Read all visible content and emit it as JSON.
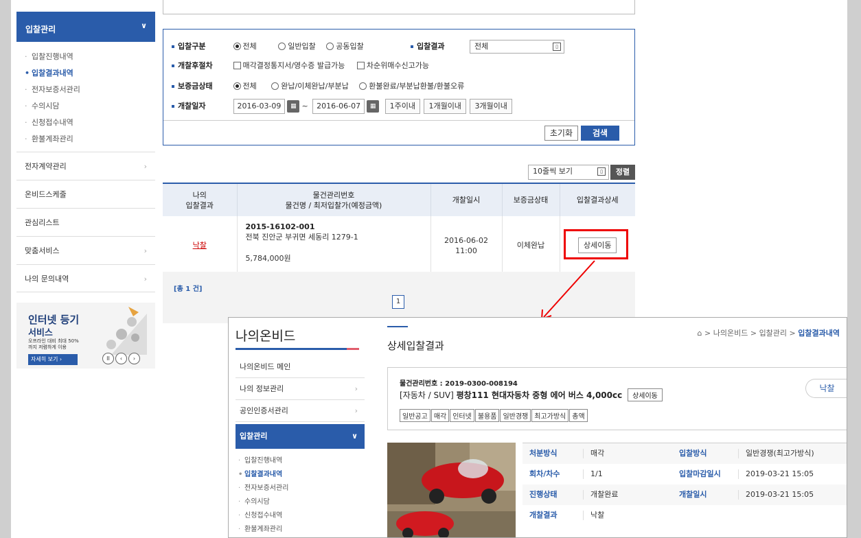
{
  "sidebar": {
    "header": "입찰관리",
    "sub_items": [
      "입찰진행내역",
      "입찰결과내역",
      "전자보증서관리",
      "수의시담",
      "신청접수내역",
      "환불계좌관리"
    ],
    "active_sub": 1,
    "menus": [
      {
        "label": "전자계약관리",
        "arrow": true
      },
      {
        "label": "온비드스케줄",
        "arrow": false
      },
      {
        "label": "관심리스트",
        "arrow": false
      },
      {
        "label": "맞춤서비스",
        "arrow": true
      },
      {
        "label": "나의 문의내역",
        "arrow": true
      }
    ]
  },
  "banner": {
    "title1": "인터넷 등기",
    "title2": "서비스",
    "desc": "오프라인 대비 최대 50%까지 저렴하게 이용",
    "button": "자세히 보기 ›"
  },
  "search": {
    "row1_label": "입찰구분",
    "row1_options": [
      "전체",
      "일반입찰",
      "공동입찰"
    ],
    "row1_selected": 0,
    "result_label": "입찰결과",
    "result_value": "전체",
    "row2_label": "개찰후절차",
    "row2_options": [
      "매각결정통지서/영수증 발급가능",
      "차순위매수신고가능"
    ],
    "row3_label": "보증금상태",
    "row3_options": [
      "전체",
      "완납/이체완납/부분납",
      "환불완료/부분납환불/환불오류"
    ],
    "row3_selected": 0,
    "row4_label": "개찰일자",
    "date_from": "2016-03-09",
    "date_sep": "~",
    "date_to": "2016-06-07",
    "period_buttons": [
      "1주이내",
      "1개월이내",
      "3개월이내"
    ],
    "reset_label": "초기화",
    "search_label": "검색"
  },
  "results": {
    "view_select": "10줄씩 보기",
    "sort_label": "정렬",
    "headers": {
      "col1a": "나의",
      "col1b": "입찰결과",
      "col2a": "물건관리번호",
      "col2b": "물건명 / 최저입찰가(예정금액)",
      "col3": "개찰일시",
      "col4": "보증금상태",
      "col5": "입찰결과상세"
    },
    "rows": [
      {
        "result": "낙찰",
        "item_no": "2015-16102-001",
        "item_name": "전북 진안군 부귀면 세동리 1279-1",
        "price": "5,784,000원",
        "date": "2016-06-02",
        "time": "11:00",
        "deposit": "이체완납",
        "detail_button": "상세이동"
      }
    ],
    "total": "[총 1 건]",
    "page": "1"
  },
  "overlay": {
    "brand": "나의온비드",
    "nav_items": [
      {
        "label": "나의온비드 메인",
        "arrow": false
      },
      {
        "label": "나의 정보관리",
        "arrow": true
      },
      {
        "label": "공인인증서관리",
        "arrow": true
      }
    ],
    "nav_selected": "입찰관리",
    "nav_sub": [
      "입찰진행내역",
      "입찰결과내역",
      "전자보증서관리",
      "수의시담",
      "신청접수내역",
      "환불계좌관리"
    ],
    "nav_sub_active": 1,
    "page_title": "상세입찰결과",
    "breadcrumb_home": "⌂",
    "breadcrumb_1": "나의온비드",
    "breadcrumb_2": "입찰관리",
    "breadcrumb_3": "입찰결과내역",
    "item_no": "물건관리번호 : 2019-0300-008194",
    "item_category": "[자동차 / SUV]",
    "item_name": "평창111 현대자동차 중형 에어 버스 4,000cc",
    "move_button": "상세이동",
    "tags": [
      "일반공고",
      "매각",
      "인터넷",
      "불용품",
      "일반경쟁",
      "최고가방식",
      "총액"
    ],
    "badge": "낙찰",
    "details": [
      {
        "k1": "처분방식",
        "v1": "매각",
        "k2": "입찰방식",
        "v2": "일반경쟁(최고가방식)"
      },
      {
        "k1": "회차/차수",
        "v1": "1/1",
        "k2": "입찰마감일시",
        "v2": "2019-03-21 15:05"
      },
      {
        "k1": "진행상태",
        "v1": "개찰완료",
        "k2": "개찰일시",
        "v2": "2019-03-21 15:05"
      },
      {
        "k1": "개찰결과",
        "v1": "낙찰",
        "k2": "",
        "v2": ""
      }
    ]
  },
  "colors": {
    "primary": "#2a5caa",
    "accent_red": "#e00000",
    "won_red": "#cc0000"
  }
}
